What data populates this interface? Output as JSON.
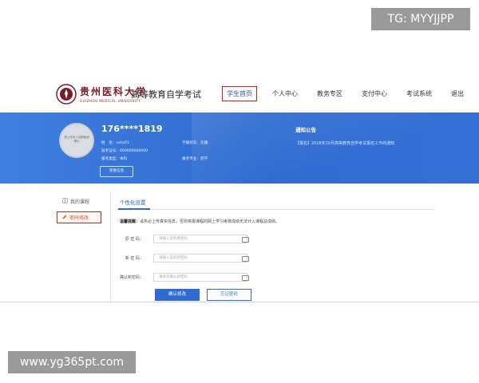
{
  "watermarks": {
    "top": "TG: MYYJJPP",
    "bottom": "www.yg365pt.com"
  },
  "header": {
    "logo_cn": "贵州医科大学",
    "logo_en": "GUIZHOU MEDICAL UNIVERSITY",
    "site_title": "高等教育自学考试",
    "nav": [
      {
        "label": "学生首页",
        "active": true
      },
      {
        "label": "个人中心",
        "active": false
      },
      {
        "label": "教务专区",
        "active": false
      },
      {
        "label": "支付中心",
        "active": false
      },
      {
        "label": "考试系统",
        "active": false
      },
      {
        "label": "退出",
        "active": false
      }
    ]
  },
  "profile": {
    "avatar_text": "请上传本人近期免冠照片",
    "phone": "176****1819",
    "name_label": "姓　名：",
    "name_value": "cehs01",
    "ticket_label": "准考证号：",
    "ticket_value": "000000000000",
    "type_label": "报考类型：",
    "type_value": "本科",
    "status_label": "学籍状态：",
    "status_value": "在籍",
    "major_label": "报考专业：",
    "major_value": "药学",
    "info_button": "完善信息"
  },
  "notice": {
    "title": "通知公告",
    "items": [
      "【报名】2016年10月高等教育自学考试报名工作的通知"
    ]
  },
  "menu": {
    "course": "我的课程",
    "password": "密码修改"
  },
  "panel": {
    "tab": "个性化设置",
    "hint_bold": "温馨提醒：",
    "hint_text": "请务必上传真实信息，否则将报课程的网上学习考核成绩无法计入课程总成绩。",
    "fields": [
      {
        "label": "原 密 码：",
        "placeholder": "请输入您的原密码"
      },
      {
        "label": "新 密 码：",
        "placeholder": "请输入您的新密码"
      },
      {
        "label": "确认新密码：",
        "placeholder": "请再次确认新密码"
      }
    ],
    "confirm_button": "确认修改",
    "forgot_button": "忘记密码"
  },
  "colors": {
    "accent": "#2f6bd0",
    "highlight_border": "#d2221a",
    "menu_active": "#e0542a"
  }
}
